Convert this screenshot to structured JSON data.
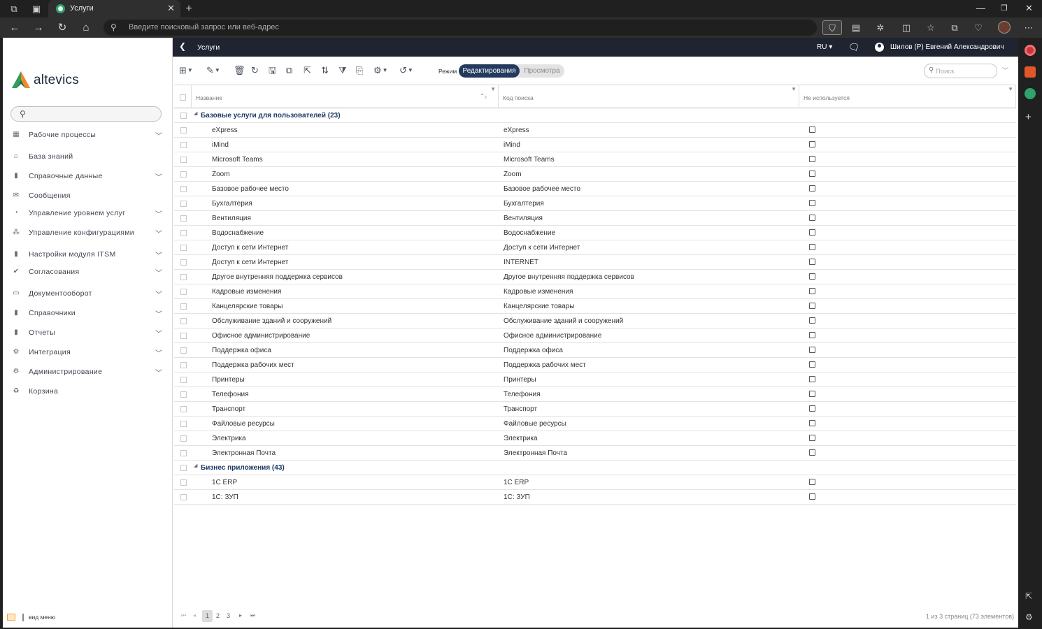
{
  "browser": {
    "tab_title": "Услуги",
    "address_placeholder": "Введите поисковый запрос или веб-адрес"
  },
  "app": {
    "logo_text": "altevics",
    "sidebar": {
      "items": [
        {
          "label": "Рабочие процессы",
          "icon": "workflow-icon",
          "expandable": true
        },
        {
          "label": "База знаний",
          "icon": "bank-icon",
          "expandable": false
        },
        {
          "label": "Справочные данные",
          "icon": "book-icon",
          "expandable": true
        },
        {
          "label": "Сообщения",
          "icon": "envelope-icon",
          "expandable": false
        },
        {
          "label": "Управление уровнем услуг",
          "icon": "pie-chart-icon",
          "expandable": true
        },
        {
          "label": "Управление конфигурациями",
          "icon": "hierarchy-icon",
          "expandable": true
        },
        {
          "label": "Настройки модуля ITSM",
          "icon": "book-icon",
          "expandable": true
        },
        {
          "label": "Согласования",
          "icon": "check-icon",
          "expandable": true
        },
        {
          "label": "Документооборот",
          "icon": "inbox-icon",
          "expandable": true
        },
        {
          "label": "Справочники",
          "icon": "book-icon",
          "expandable": true
        },
        {
          "label": "Отчеты",
          "icon": "book-icon",
          "expandable": true
        },
        {
          "label": "Интеграция",
          "icon": "gear-icon",
          "expandable": true
        },
        {
          "label": "Администрирование",
          "icon": "gear-icon",
          "expandable": true
        },
        {
          "label": "Корзина",
          "icon": "recycle-icon",
          "expandable": false
        }
      ],
      "footer_label": "вид меню"
    },
    "header": {
      "page_title": "Услуги",
      "language": "RU",
      "user_name": "Шилов (Р) Евгений Александрович"
    },
    "toolbar": {
      "mode_label": "Режим",
      "mode_edit": "Редактирования",
      "mode_view": "Просмотра",
      "search_placeholder": "Поиск"
    },
    "grid": {
      "columns": [
        "Название",
        "Код поиска",
        "Не используется"
      ],
      "groups": [
        {
          "label": "Базовые услуги для пользователей (23)",
          "rows": [
            {
              "name": "eXpress",
              "code": "eXpress"
            },
            {
              "name": "iMind",
              "code": "iMind"
            },
            {
              "name": "Microsoft Teams",
              "code": "Microsoft Teams"
            },
            {
              "name": "Zoom",
              "code": "Zoom"
            },
            {
              "name": "Базовое рабочее место",
              "code": "Базовое рабочее место"
            },
            {
              "name": "Бухгалтерия",
              "code": "Бухгалтерия"
            },
            {
              "name": "Вентиляция",
              "code": "Вентиляция"
            },
            {
              "name": "Водоснабжение",
              "code": "Водоснабжение"
            },
            {
              "name": "Доступ к сети Интернет",
              "code": "Доступ к сети Интернет"
            },
            {
              "name": "Доступ к сети Интернет",
              "code": "INTERNET"
            },
            {
              "name": "Другое внутренняя поддержка сервисов",
              "code": "Другое внутренняя поддержка сервисов"
            },
            {
              "name": "Кадровые изменения",
              "code": "Кадровые изменения"
            },
            {
              "name": "Канцелярские товары",
              "code": "Канцелярские товары"
            },
            {
              "name": "Обслуживание зданий и сооружений",
              "code": "Обслуживание зданий и сооружений"
            },
            {
              "name": "Офисное администрирование",
              "code": "Офисное администрирование"
            },
            {
              "name": "Поддержка офиса",
              "code": "Поддержка офиса"
            },
            {
              "name": "Поддержка рабочих мест",
              "code": "Поддержка рабочих мест"
            },
            {
              "name": "Принтеры",
              "code": "Принтеры"
            },
            {
              "name": "Телефония",
              "code": "Телефония"
            },
            {
              "name": "Транспорт",
              "code": "Транспорт"
            },
            {
              "name": "Файловые ресурсы",
              "code": "Файловые ресурсы"
            },
            {
              "name": "Электрика",
              "code": "Электрика"
            },
            {
              "name": "Электронная Почта",
              "code": "Электронная Почта"
            }
          ]
        },
        {
          "label": "Бизнес приложения (43)",
          "rows": [
            {
              "name": "1С ERP",
              "code": "1С ERP"
            },
            {
              "name": "1С: ЗУП",
              "code": "1С: ЗУП"
            }
          ]
        }
      ]
    },
    "pager": {
      "pages": [
        "1",
        "2",
        "3"
      ],
      "current_page": "1",
      "info": "1 из 3 страниц (73 элементов)"
    }
  }
}
